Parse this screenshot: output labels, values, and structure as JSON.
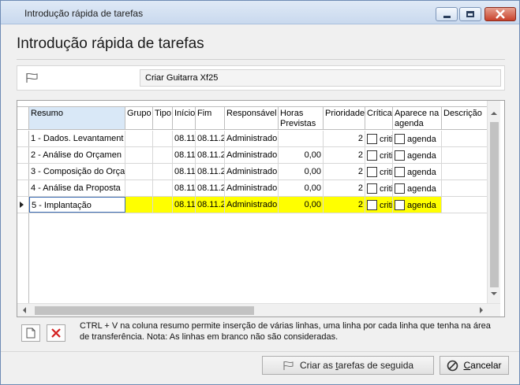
{
  "window": {
    "title": "Introdução rápida de tarefas"
  },
  "page": {
    "heading": "Introdução rápida de tarefas",
    "task_name": "Criar Guitarra Xf25"
  },
  "grid": {
    "columns": [
      {
        "key": "resumo",
        "label": "Resumo"
      },
      {
        "key": "grupo",
        "label": "Grupo"
      },
      {
        "key": "tipo",
        "label": "Tipo"
      },
      {
        "key": "inicio",
        "label": "Início"
      },
      {
        "key": "fim",
        "label": "Fim"
      },
      {
        "key": "responsavel",
        "label": "Responsável"
      },
      {
        "key": "horas",
        "label": "Horas Previstas"
      },
      {
        "key": "prioridade",
        "label": "Prioridade"
      },
      {
        "key": "critica",
        "label": "Crítica"
      },
      {
        "key": "agenda",
        "label": "Aparece na agenda"
      },
      {
        "key": "descricao",
        "label": "Descrição"
      }
    ],
    "rows": [
      {
        "resumo": "1 - Dados. Levantament",
        "inicio": "08.11",
        "fim": "08.11.2",
        "responsavel": "Administrado",
        "horas": "",
        "prioridade": "2",
        "critica": "critic",
        "agenda": "agenda"
      },
      {
        "resumo": "2 - Análise do Orçamen",
        "inicio": "08.11",
        "fim": "08.11.2",
        "responsavel": "Administrado",
        "horas": "0,00",
        "prioridade": "2",
        "critica": "critic",
        "agenda": "agenda"
      },
      {
        "resumo": "3 - Composição do Orça",
        "inicio": "08.11",
        "fim": "08.11.2",
        "responsavel": "Administrado",
        "horas": "0,00",
        "prioridade": "2",
        "critica": "critic",
        "agenda": "agenda"
      },
      {
        "resumo": "4 - Análise da Proposta",
        "inicio": "08.11",
        "fim": "08.11.2",
        "responsavel": "Administrado",
        "horas": "0,00",
        "prioridade": "2",
        "critica": "critic",
        "agenda": "agenda"
      },
      {
        "resumo": "5 - Implantação",
        "inicio": "08.11",
        "fim": "08.11.2",
        "responsavel": "Administrado",
        "horas": "0,00",
        "prioridade": "2",
        "critica": "critic",
        "agenda": "agenda"
      }
    ]
  },
  "hint": "CTRL + V na coluna resumo permite inserção de várias linhas, uma linha por cada linha que tenha na área de transferência. Nota: As linhas em branco não são consideradas.",
  "buttons": {
    "create_prefix": "Criar as ",
    "create_underlined": "t",
    "create_suffix": "arefas de seguida",
    "cancel_underlined": "C",
    "cancel_suffix": "ancelar"
  },
  "colors": {
    "active_row": "#ffff00",
    "header_highlight": "#d9e8f7",
    "delete_red": "#d42020"
  }
}
